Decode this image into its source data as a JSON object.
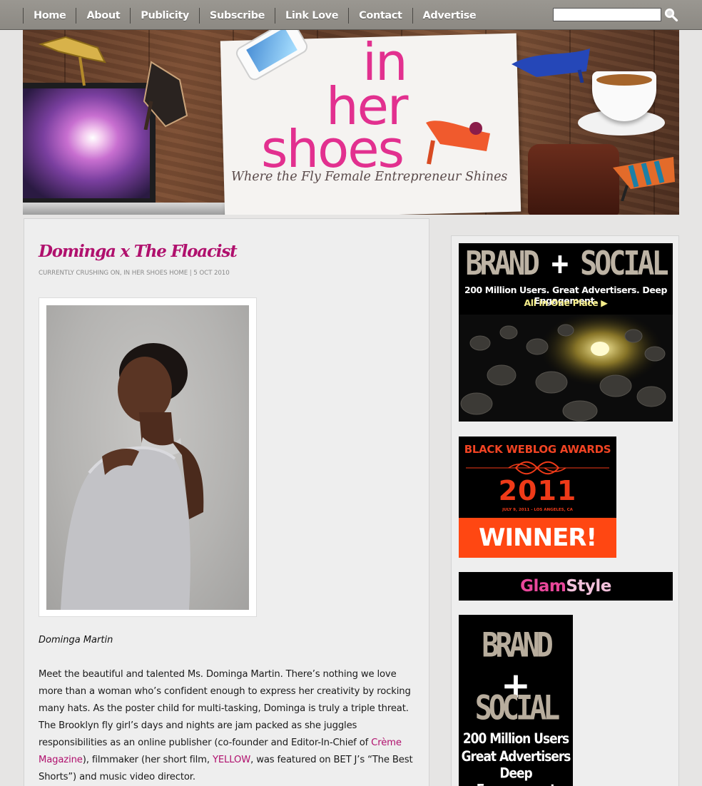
{
  "nav": {
    "items": [
      {
        "label": "Home"
      },
      {
        "label": "About"
      },
      {
        "label": "Publicity"
      },
      {
        "label": "Subscribe"
      },
      {
        "label": "Link Love"
      },
      {
        "label": "Contact"
      },
      {
        "label": "Advertise"
      }
    ],
    "search": {
      "value": "",
      "icon": "magnifier-icon"
    }
  },
  "banner": {
    "title_words": [
      "in",
      "her",
      "shoes"
    ],
    "tagline": "Where the Fly Female Entrepreneur Shines"
  },
  "post": {
    "title": "Dominga x The Floacist",
    "meta": {
      "categories": [
        "CURRENTLY CRUSHING ON",
        "IN HER SHOES HOME"
      ],
      "separator": ", ",
      "divider": "|",
      "date": "5 OCT 2010"
    },
    "photo_caption": "Dominga Martin",
    "body": {
      "p1_a": "Meet the beautiful and talented Ms. Dominga Martin. There’s nothing we love more than a woman who’s confident enough to express her creativity by rocking many hats. As the poster child for multi-tasking, Dominga is truly a triple threat. The Brooklyn fly girl’s days and nights are jam packed as she juggles responsibilities as an online publisher (co-founder and Editor-In-Chief of ",
      "link_magazine": "Crème Magazine",
      "p1_b": "), filmmaker (her short film, ",
      "link_film": "YELLOW",
      "p1_c": ", was featured on BET J’s “The Best Shorts”) and music video director."
    }
  },
  "sidebar": {
    "ad_brand_social_large": {
      "brand": "BRAND",
      "plus": "+",
      "social": "SOCIAL",
      "line1": "200 Million Users.  Great Advertisers.  Deep Engagement.",
      "cta": "All in One Place ▶"
    },
    "ad_black_weblog": {
      "title": "BLACK WEBLOG AWARDS",
      "year": "2011",
      "date_location": "JULY 9, 2011 - LOS ANGELES, CA",
      "banner": "WINNER!"
    },
    "ad_glamstyle": {
      "part1": "Glam",
      "part2": "Style"
    },
    "ad_brand_social_small": {
      "brand": "BRAND",
      "plus": "+",
      "social": "SOCIAL",
      "lines": [
        "200 Million Users",
        "Great Advertisers",
        "Deep Engagement"
      ]
    }
  },
  "colors": {
    "accent_pink": "#b0106d",
    "banner_pink": "#e2308f",
    "nav_bg": "#938f89",
    "award_orange": "#ff4712"
  }
}
